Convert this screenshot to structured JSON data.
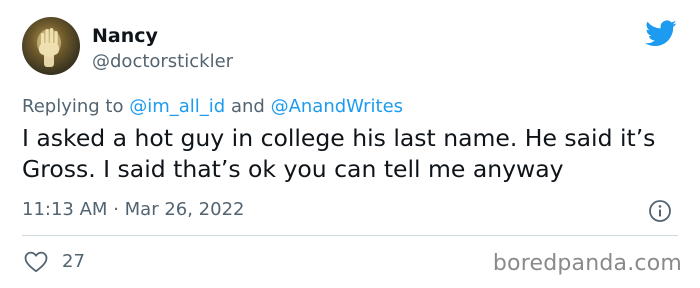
{
  "author": {
    "display_name": "Nancy",
    "handle": "@doctorstickler",
    "avatar_icon": "hand-avatar"
  },
  "reply": {
    "prefix": "Replying to",
    "mention_1": "@im_all_id",
    "conjunction": "and",
    "mention_2": "@AnandWrites"
  },
  "tweet": {
    "text": "I asked a hot guy in college his last name. He said it’s Gross. I said that’s ok you can tell me anyway",
    "time": "11:13 AM",
    "separator": "·",
    "date": "Mar 26, 2022"
  },
  "engagement": {
    "likes": "27"
  },
  "watermark": "boredpanda.com",
  "colors": {
    "twitter_blue": "#1d9bf0",
    "text_primary": "#0f1419",
    "text_secondary": "#536471",
    "divider": "#cfd9de"
  },
  "icons": {
    "brand": "twitter-bird-icon",
    "info": "info-icon",
    "like": "heart-icon"
  }
}
